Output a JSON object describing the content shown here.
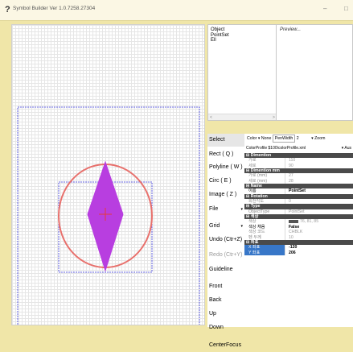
{
  "titlebar": {
    "title": "Symbol Builder Ver 1.0.7258.27304",
    "app_icon": "?",
    "min_glyph": "–",
    "max_glyph": "□",
    "colors": {
      "background": "#fbf7e4"
    }
  },
  "object_list": {
    "items": [
      "Object",
      "PointSet",
      "Ell"
    ],
    "scroll_left": "<",
    "scroll_right": ">"
  },
  "preview": {
    "label": "Preview..."
  },
  "tools": [
    {
      "label": "Select",
      "selected": true
    },
    {
      "label": "Rect ( Q )"
    },
    {
      "label": "Polyline ( W )"
    },
    {
      "label": "Circ ( E )"
    },
    {
      "label": "Image ( Z )"
    },
    {
      "label": "File",
      "caret": "▾"
    },
    {
      "label": "Grid",
      "caret": "▾"
    },
    {
      "label": "Undo (Ctr+Z)"
    },
    {
      "label": "Redo (Ctr+Y)",
      "disabled": true
    },
    {
      "label": "Guideline"
    },
    {
      "label": "Front"
    },
    {
      "label": "Back"
    },
    {
      "label": "Up"
    },
    {
      "label": "Down"
    },
    {
      "label": "CenterFocus"
    }
  ],
  "props_toolbar": {
    "color_label": "Color",
    "color_caret": "▾",
    "color_value": "None",
    "penwidth_label": "PenWidth",
    "penwidth_value": "2",
    "zoom_caret": "▾",
    "zoom_label": "Zoom",
    "colorprofile_label": "ColorProfile",
    "colorprofile_value": "$100\\colorProfile.xml",
    "colorprofile_extra": "▾ Aus"
  },
  "properties": [
    {
      "type": "cat",
      "label": "Dimention"
    },
    {
      "type": "kv",
      "key": "가로",
      "value": "110"
    },
    {
      "type": "kv",
      "key": "세로",
      "value": "90"
    },
    {
      "type": "cat",
      "label": "Dimention mm"
    },
    {
      "type": "kv",
      "key": "가로 (mm)",
      "value": "27"
    },
    {
      "type": "kv",
      "key": "세로 (mm)",
      "value": "28"
    },
    {
      "type": "cat",
      "label": "Name"
    },
    {
      "type": "kv",
      "key": "이름",
      "value": "PointSet",
      "bold": true,
      "darkkey": true
    },
    {
      "type": "cat",
      "label": "Rotation"
    },
    {
      "type": "kv",
      "key": "회전각도",
      "value": "0"
    },
    {
      "type": "cat",
      "label": "Type"
    },
    {
      "type": "kv",
      "key": "ObjectType",
      "value": "PointSet"
    },
    {
      "type": "cat",
      "label": "색상"
    },
    {
      "type": "kv",
      "key": "색상",
      "value": "76, 81, 85",
      "swatch": "#555555"
    },
    {
      "type": "kv",
      "key": "색상 채움",
      "value": "False",
      "bold": true,
      "darkkey": true
    },
    {
      "type": "kv",
      "key": "색상 코드",
      "value": "CHBLK"
    },
    {
      "type": "kv",
      "key": "펜 두께",
      "value": "10"
    },
    {
      "type": "cat",
      "label": "좌표"
    },
    {
      "type": "kv",
      "key": "X 좌표",
      "value": "-120",
      "bold": true,
      "highlight": true
    },
    {
      "type": "kv",
      "key": "Y 좌표",
      "value": "206",
      "bold": true,
      "highlight": true
    }
  ],
  "canvas": {
    "colors": {
      "outer_guide": "#3b3bdd",
      "ellipse": "#e8706c",
      "diamond": "#b83ee0",
      "center_cross": "#e33b3b"
    }
  }
}
